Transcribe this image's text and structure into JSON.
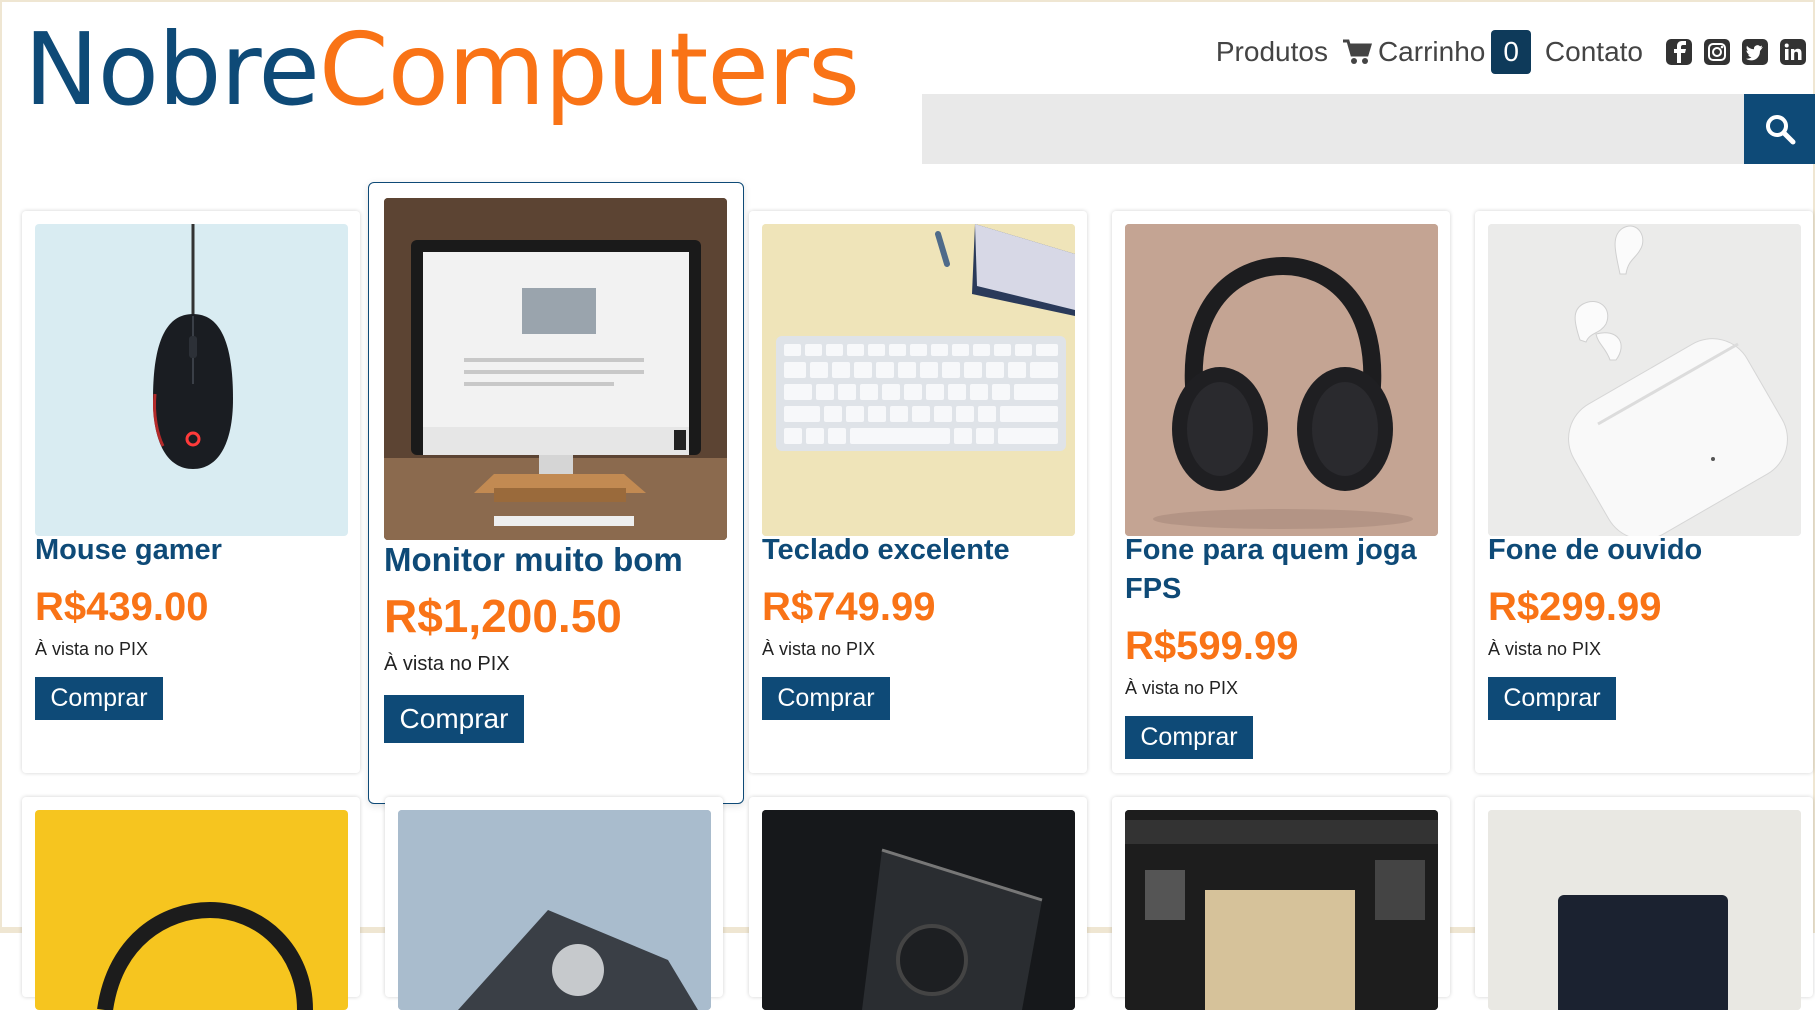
{
  "brand": {
    "part1": "Nobre",
    "part2": "Computers"
  },
  "nav": {
    "products": "Produtos",
    "cart": "Carrinho",
    "cart_count": "0",
    "contact": "Contato",
    "social": [
      "facebook-icon",
      "instagram-icon",
      "twitter-icon",
      "linkedin-icon"
    ]
  },
  "search": {
    "placeholder": ""
  },
  "products": [
    {
      "name": "Mouse gamer",
      "price": "R$439.00",
      "payment_note": "À vista no PIX",
      "buy_label": "Comprar"
    },
    {
      "name": "Monitor muito bom",
      "price": "R$1,200.50",
      "payment_note": "À vista no PIX",
      "buy_label": "Comprar"
    },
    {
      "name": "Teclado excelente",
      "price": "R$749.99",
      "payment_note": "À vista no PIX",
      "buy_label": "Comprar"
    },
    {
      "name": "Fone para quem joga FPS",
      "price": "R$599.99",
      "payment_note": "À vista no PIX",
      "buy_label": "Comprar"
    },
    {
      "name": "Fone de ouvido",
      "price": "R$299.99",
      "payment_note": "À vista no PIX",
      "buy_label": "Comprar"
    }
  ],
  "colors": {
    "brand_blue": "#0e4a77",
    "brand_orange": "#f97316",
    "search_bg": "#e9e9e9"
  }
}
